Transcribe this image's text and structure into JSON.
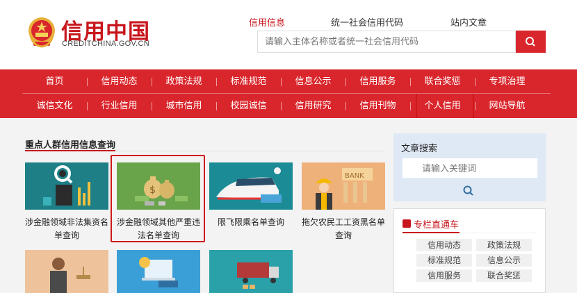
{
  "header": {
    "site_name": "信用中国",
    "site_domain": "CREDITCHINA.GOV.CN",
    "search_tabs": [
      "信用信息",
      "统一社会信用代码",
      "站内文章"
    ],
    "search_placeholder": "请输入主体名称或者统一社会信用代码"
  },
  "nav": {
    "row1": [
      "首页",
      "信用动态",
      "政策法规",
      "标准规范",
      "信息公示",
      "信用服务",
      "联合奖惩",
      "专项治理"
    ],
    "row2": [
      "诚信文化",
      "行业信用",
      "城市信用",
      "校园诚信",
      "信用研究",
      "信用刊物",
      "个人信用",
      "网站导航"
    ]
  },
  "main": {
    "section_title": "重点人群信用信息查询",
    "cards": [
      {
        "label": "涉金融领域非法集资名单查询"
      },
      {
        "label": "涉金融领域其他严重违法名单查询"
      },
      {
        "label": "限飞限乘名单查询"
      },
      {
        "label": "拖欠农民工工资黑名单查询"
      }
    ]
  },
  "sidebar": {
    "search_title": "文章搜索",
    "search_placeholder": "请输入关键词",
    "column_title": "专栏直通车",
    "tags": [
      "信用动态",
      "政策法规",
      "标准规范",
      "信息公示",
      "信用服务",
      "联合奖惩"
    ]
  },
  "icons": {
    "search": "search-icon",
    "column": "column-icon",
    "emblem": "national-emblem-icon"
  },
  "colors": {
    "brand_red": "#d9262c",
    "text_red": "#c8161d",
    "sidebar_blue": "#dfe9f5"
  }
}
